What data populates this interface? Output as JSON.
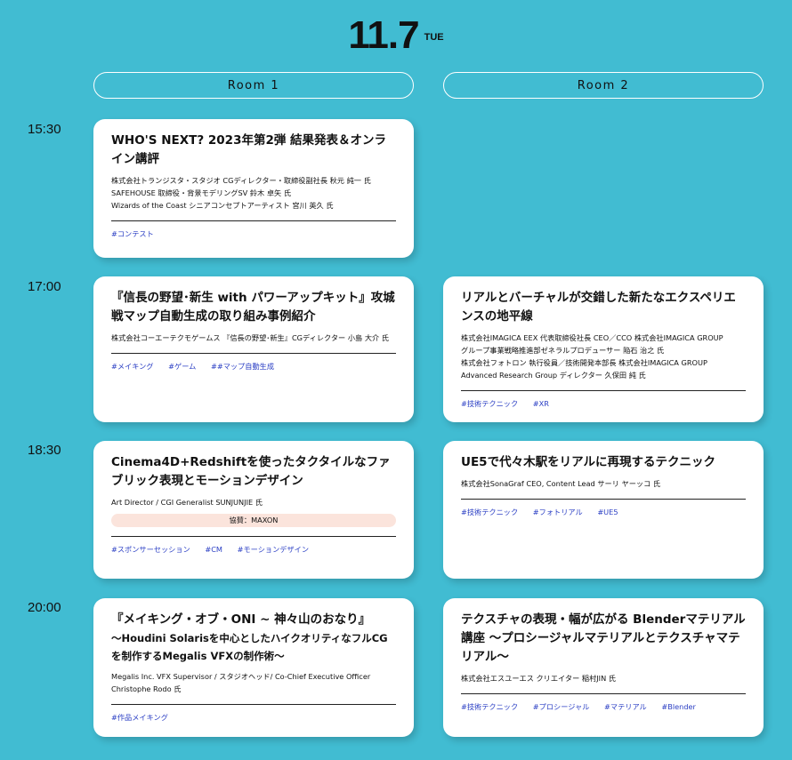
{
  "header": {
    "day": "11.7",
    "weekday": "TUE"
  },
  "rooms": [
    "Room 1",
    "Room 2"
  ],
  "times": [
    "15:30",
    "17:00",
    "18:30",
    "20:00"
  ],
  "sessions": {
    "s1": {
      "title": "WHO'S NEXT? 2023年第2弾 結果発表＆オンライン講評",
      "people": [
        "株式会社トランジスタ・スタジオ  CGディレクター・取締役副社長  秋元 純一 氏",
        "SAFEHOUSE  取締役・背景モデリングSV  鈴木 卓矢 氏",
        "Wizards of the Coast  シニアコンセプトアーティスト  宮川 英久 氏"
      ],
      "tags": [
        "#コンテスト"
      ]
    },
    "s2": {
      "title": "『信長の野望･新生 with パワーアップキット』攻城戦マップ自動生成の取り組み事例紹介",
      "people": [
        "株式会社コーエーテクモゲームス 『信長の野望･新生』CGディレクター  小島 大介 氏"
      ],
      "tags": [
        "#メイキング",
        "#ゲーム",
        "##マップ自動生成"
      ]
    },
    "s3": {
      "title": "リアルとバーチャルが交錯した新たなエクスペリエンスの地平線",
      "people": [
        "株式会社IMAGICA EEX  代表取締役社長 CEO／CCO  株式会社IMAGICA GROUP",
        "グループ事業戦略推進部ゼネラルプロデューサー  陥石 治之 氏",
        "株式会社フォトロン  執行役員／技術開発本部長  株式会社IMAGICA GROUP",
        "Advanced Research Group ディレクター  久保田 純 氏"
      ],
      "tags": [
        "#技術テクニック",
        "#XR"
      ]
    },
    "s4": {
      "title": "Cinema4D+Redshiftを使ったタクタイルなファブリック表現とモーションデザイン",
      "people": [
        "Art Director / CGI Generalist  SUNJUNJIE 氏"
      ],
      "sponsor": "協賛：MAXON",
      "tags": [
        "#スポンサーセッション",
        "#CM",
        "#モーションデザイン"
      ]
    },
    "s5": {
      "title": "UE5で代々木駅をリアルに再現するテクニック",
      "people": [
        "株式会社SonaGraf  CEO, Content Lead  サーリ ヤーッコ 氏"
      ],
      "tags": [
        "#技術テクニック",
        "#フォトリアル",
        "#UE5"
      ]
    },
    "s6": {
      "title": "『メイキング・オブ・ONI ~ 神々山のおなり』",
      "subtitle": "～Houdini Solarisを中心としたハイクオリティなフルCGを制作するMegalis VFXの制作術～",
      "people": [
        "Megalis Inc.  VFX Supervisor / スタジオヘッド/ Co-Chief Executive Officer Christophe Rodo 氏"
      ],
      "tags": [
        "#作品メイキング"
      ]
    },
    "s7": {
      "title": "テクスチャの表現・幅が広がる Blenderマテリアル講座 ～プロシージャルマテリアルとテクスチャマテリアル～",
      "people": [
        "株式会社エスユーエス  クリエイター  稲村JIN 氏"
      ],
      "tags": [
        "#技術テクニック",
        "#プロシージャル",
        "#マテリアル",
        "#Blender"
      ]
    }
  }
}
